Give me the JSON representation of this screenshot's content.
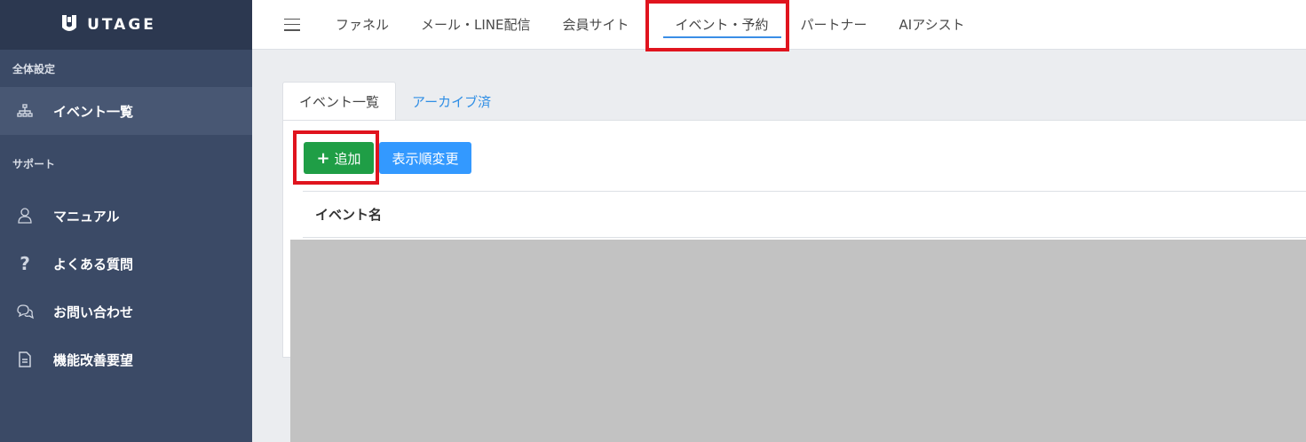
{
  "brand": {
    "name": "UTAGE"
  },
  "sidebar": {
    "section1_label": "全体設定",
    "section2_label": "サポート",
    "items": [
      {
        "label": "イベント一覧",
        "icon": "sitemap-icon",
        "active": true
      },
      {
        "label": "マニュアル",
        "icon": "user-icon",
        "active": false
      },
      {
        "label": "よくある質問",
        "icon": "question-icon",
        "active": false
      },
      {
        "label": "お問い合わせ",
        "icon": "chat-icon",
        "active": false
      },
      {
        "label": "機能改善要望",
        "icon": "document-icon",
        "active": false
      }
    ]
  },
  "topnav": {
    "tabs": [
      {
        "label": "ファネル"
      },
      {
        "label": "メール・LINE配信"
      },
      {
        "label": "会員サイト"
      },
      {
        "label": "イベント・予約",
        "active": true
      },
      {
        "label": "パートナー"
      },
      {
        "label": "AIアシスト"
      }
    ]
  },
  "content_tabs": [
    {
      "label": "イベント一覧",
      "active": true
    },
    {
      "label": "アーカイブ済",
      "active": false
    }
  ],
  "toolbar": {
    "add_label": "追加",
    "add_icon": "plus-icon",
    "reorder_label": "表示順変更"
  },
  "table": {
    "columns": [
      "イベント名"
    ]
  },
  "colors": {
    "sidebar_bg": "#3b4a66",
    "add_button": "#1f9e46",
    "reorder_button": "#3399ff",
    "highlight": "#e0141e",
    "link": "#2f8ee5"
  }
}
